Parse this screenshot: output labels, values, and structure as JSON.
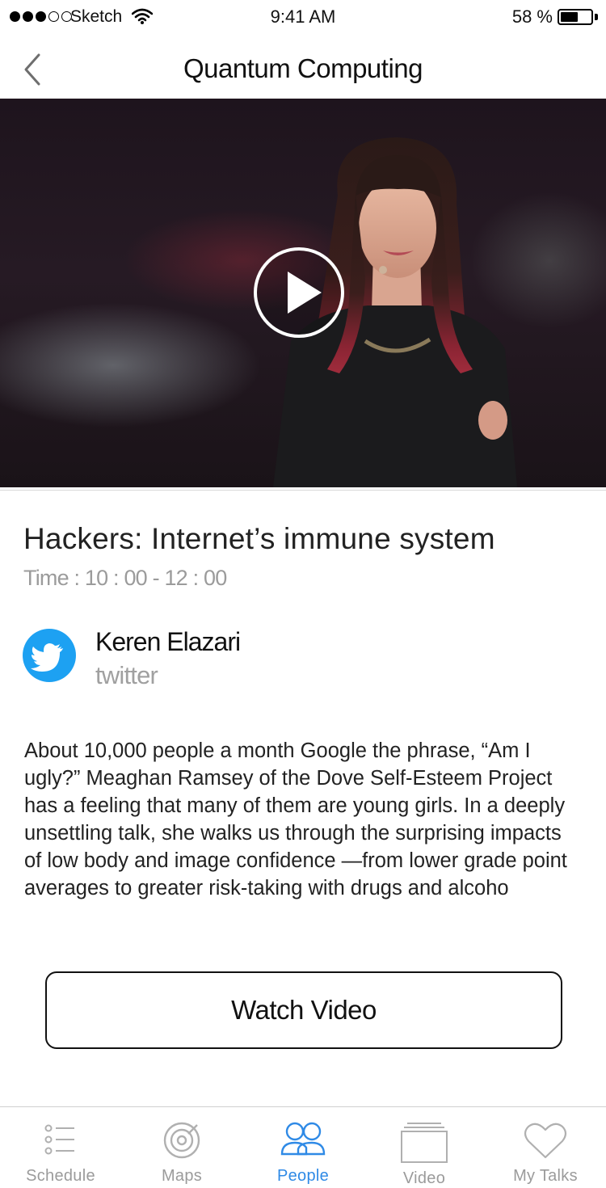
{
  "status_bar": {
    "carrier": "Sketch",
    "time": "9:41 AM",
    "battery_percent": "58 %",
    "battery_level": 0.58,
    "signal_bars_filled": 3,
    "signal_bars_total": 5
  },
  "nav": {
    "title": "Quantum Computing",
    "back_icon": "chevron-left-icon"
  },
  "video": {
    "play_icon": "play-icon"
  },
  "talk": {
    "title": "Hackers: Internet’s immune system",
    "time": "Time : 10 : 00 - 12 : 00"
  },
  "speaker": {
    "name": "Keren Elazari",
    "handle": "twitter",
    "icon": "twitter-icon",
    "icon_color": "#1da1f2"
  },
  "description": "About 10,000 people a month Google the phrase, “Am I ugly?” Meaghan Ramsey of the Dove Self-Esteem Project has a feeling that many of them are young girls. In a deeply unsettling talk, she walks us through the surprising impacts of low body and image confidence —from lower grade point averages to greater risk-taking with drugs and alcoho",
  "watch_button": {
    "label": "Watch Video"
  },
  "tab_bar": {
    "active_color": "#2f8ae6",
    "inactive_color": "#9b9b9b",
    "tabs": [
      {
        "label": "Schedule",
        "icon": "list-icon",
        "active": false
      },
      {
        "label": "Maps",
        "icon": "target-icon",
        "active": false
      },
      {
        "label": "People",
        "icon": "people-icon",
        "active": true
      },
      {
        "label": "Video",
        "icon": "video-stack-icon",
        "active": false
      },
      {
        "label": "My Talks",
        "icon": "heart-icon",
        "active": false
      }
    ]
  }
}
